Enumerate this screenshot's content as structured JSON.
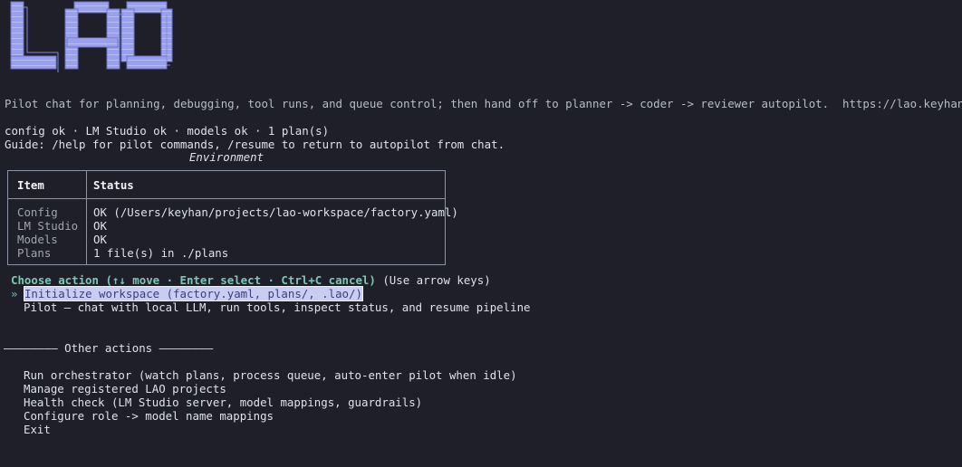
{
  "colors": {
    "background": "#1e1f29",
    "logo_fill": "#9aa0f0",
    "logo_line": "#6f75c8",
    "accent_prompt": "#7ec8b0",
    "selection_bg": "#c9cdf2"
  },
  "header": {
    "logo_text": "LAO",
    "tagline": "Pilot chat for planning, debugging, tool runs, and queue control; then hand off to planner -> coder -> reviewer autopilot.  https://lao.keyhan.info"
  },
  "status_line": "config ok · LM Studio ok · models ok · 1 plan(s)",
  "guide_line": "Guide: /help for pilot commands, /resume to return to autopilot from chat.",
  "environment": {
    "title": "Environment",
    "columns": [
      "Item",
      "Status"
    ],
    "rows": [
      {
        "item": "Config",
        "status": "OK (/Users/keyhan/projects/lao-workspace/factory.yaml)"
      },
      {
        "item": "LM Studio",
        "status": "OK"
      },
      {
        "item": "Models",
        "status": "OK"
      },
      {
        "item": "Plans",
        "status": "1 file(s) in ./plans"
      }
    ]
  },
  "menu": {
    "prompt": "Choose action",
    "keys_hint": "(↑↓ move · Enter select · Ctrl+C cancel)",
    "arrow_hint": "(Use arrow keys)",
    "pointer": "»",
    "options": [
      "Initialize workspace (factory.yaml, plans/, .lao/)",
      "Pilot — chat with local LLM, run tools, inspect status, and resume pipeline"
    ],
    "separator": "———————— Other actions ————————",
    "other_options": [
      "Run orchestrator (watch plans, process queue, auto-enter pilot when idle)",
      "Manage registered LAO projects",
      "Health check (LM Studio server, model mappings, guardrails)",
      "Configure role -> model name mappings",
      "Exit"
    ]
  }
}
